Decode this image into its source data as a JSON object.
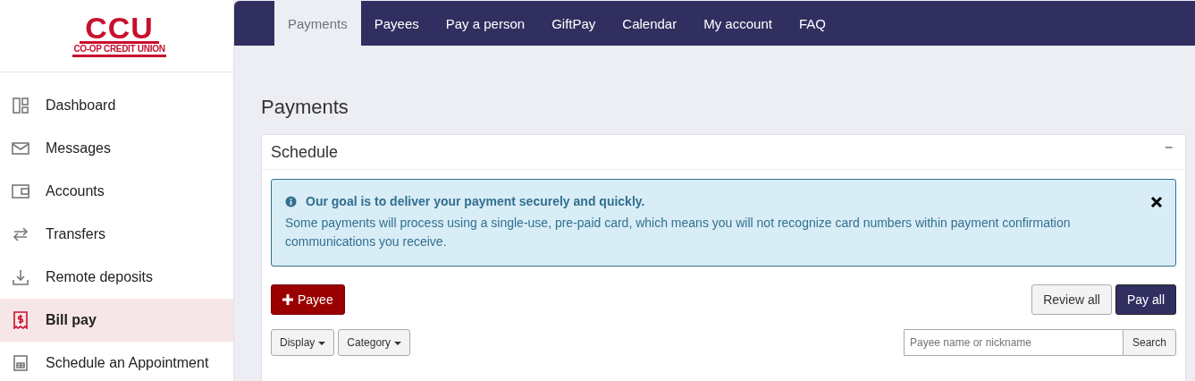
{
  "logo": {
    "mark": "CCU",
    "name": "CO-OP CREDIT UNION"
  },
  "sidebar": {
    "items": [
      {
        "label": "Dashboard",
        "selected": false
      },
      {
        "label": "Messages",
        "selected": false
      },
      {
        "label": "Accounts",
        "selected": false
      },
      {
        "label": "Transfers",
        "selected": false
      },
      {
        "label": "Remote deposits",
        "selected": false
      },
      {
        "label": "Bill pay",
        "selected": true
      },
      {
        "label": "Schedule an Appointment",
        "selected": false
      }
    ]
  },
  "tabs": [
    {
      "label": "Payments",
      "selected": true
    },
    {
      "label": "Payees",
      "selected": false
    },
    {
      "label": "Pay a person",
      "selected": false
    },
    {
      "label": "GiftPay",
      "selected": false
    },
    {
      "label": "Calendar",
      "selected": false
    },
    {
      "label": "My account",
      "selected": false
    },
    {
      "label": "FAQ",
      "selected": false
    }
  ],
  "page_title": "Payments",
  "panel": {
    "title": "Schedule",
    "collapse": "−",
    "alert": {
      "heading": "Our goal is to deliver your payment securely and quickly.",
      "body": "Some payments will process using a single-use, pre-paid card, which means you will not recognize card numbers within payment confirmation communications you receive."
    },
    "add_button": "Payee",
    "review_button": "Review all",
    "pay_button": "Pay all",
    "filters": [
      "Display",
      "Category"
    ],
    "search": {
      "placeholder": "Payee name or nickname",
      "button": "Search"
    }
  }
}
